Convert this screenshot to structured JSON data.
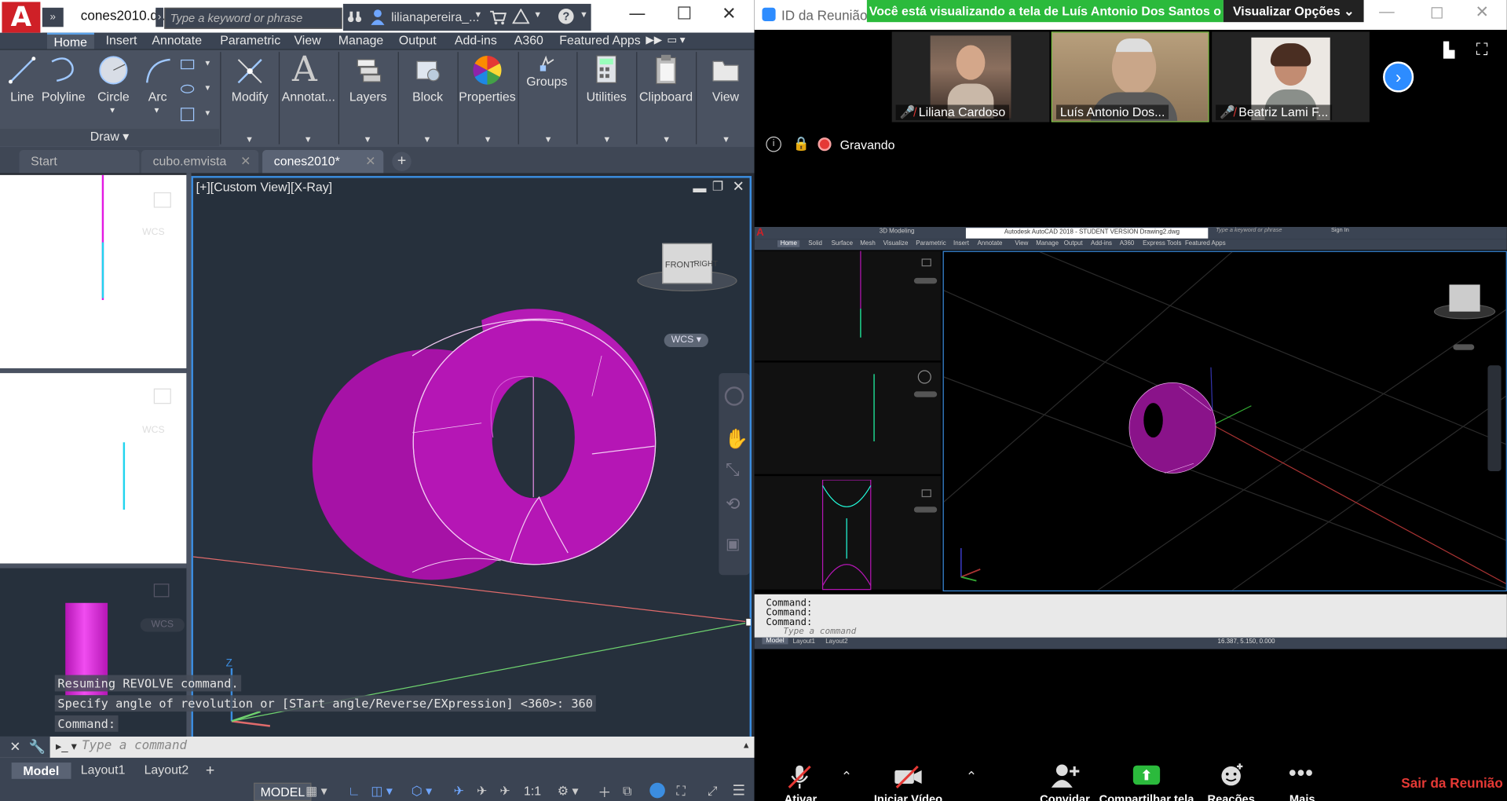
{
  "acad": {
    "logo": "A",
    "doc_tab": "cones2010.d...",
    "search_placeholder": "Type a keyword or phrase",
    "user": "lilianapereira_...",
    "menu": [
      "Home",
      "Insert",
      "Annotate",
      "Parametric",
      "View",
      "Manage",
      "Output",
      "Add-ins",
      "A360",
      "Featured Apps"
    ],
    "ribbon": {
      "draw_tools": [
        "Line",
        "Polyline",
        "Circle",
        "Arc"
      ],
      "draw_panel": "Draw",
      "panels": [
        "Modify",
        "Annotat...",
        "Layers",
        "Block",
        "Properties",
        "Groups",
        "Utilities",
        "Clipboard",
        "View"
      ]
    },
    "file_tabs": [
      "Start",
      "cubo.emvista",
      "cones2010*"
    ],
    "viewport_label": "[+][Custom View][X-Ray]",
    "viewcube": {
      "front": "FRONT",
      "right": "RIGHT"
    },
    "wcs": "WCS",
    "command_history": [
      "Resuming REVOLVE command.",
      "Specify angle of revolution or [STart angle/Reverse/EXpression] <360>: 360",
      "Command:"
    ],
    "command_placeholder": "Type a command",
    "layout_tabs": [
      "Model",
      "Layout1",
      "Layout2"
    ],
    "status_model": "MODEL",
    "status_scale": "1:1",
    "colors": {
      "solid": "#b516b5",
      "accent": "#3b8de0"
    }
  },
  "zoom": {
    "meeting_id": "ID da Reunião Z",
    "banner": "Você está visualizando a tela de Luís Antonio Dos Santos o",
    "view_options": "Visualizar Opções",
    "participants": [
      {
        "name": "Liliana Cardoso",
        "muted": true
      },
      {
        "name": "Luís Antonio Dos...",
        "muted": false
      },
      {
        "name": "Beatriz Lami F...",
        "muted": true
      }
    ],
    "recording": "Gravando",
    "shared_screen": {
      "title": "Autodesk AutoCAD 2018 - STUDENT VERSION   Drawing2.dwg",
      "workspace": "3D Modeling",
      "search": "Type a keyword or phrase",
      "signin": "Sign In",
      "tabs": [
        "Home",
        "Solid",
        "Surface",
        "Mesh",
        "Visualize",
        "Parametric",
        "Insert",
        "Annotate",
        "View",
        "Manage",
        "Output",
        "Add-ins",
        "A360",
        "Express Tools",
        "Featured Apps"
      ],
      "commands": [
        "Command:",
        "Command:",
        "Command:"
      ],
      "placeholder": "Type a command",
      "layout_tabs": [
        "Model",
        "Layout1",
        "Layout2"
      ],
      "coords": "16.387, 5.150, 0.000"
    },
    "toolbar": [
      "Ativar",
      "Iniciar Vídeo",
      "Convidar",
      "Compartilhar tela",
      "Reações",
      "Mais"
    ],
    "leave": "Sair da Reunião"
  }
}
